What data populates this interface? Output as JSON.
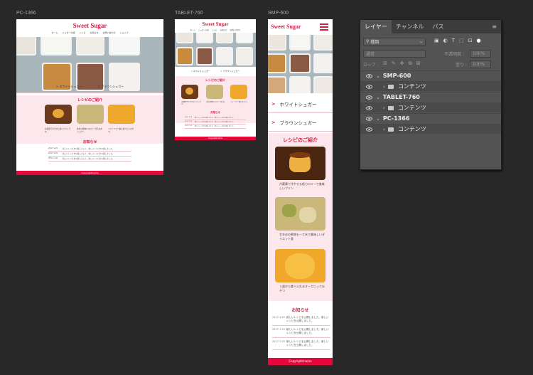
{
  "artboards": {
    "pc": {
      "label": "PC-1366",
      "logo": "Sweet Sugar",
      "nav": [
        "ホーム",
        "シュガーの話",
        "レシピ",
        "お知らせ",
        "お問い合わせ",
        "ショップ"
      ],
      "links": [
        "ホワイトシュガー",
        "ブラウンシュガー"
      ],
      "recipe_title": "レシピのご紹介",
      "recipes": [
        "冷蔵庫で冷やすと甘いプリンです。",
        "甘めの煮物にカロリー控えめのシュガー。",
        "フルーツと一緒に食べたいおやつ。"
      ],
      "news_title": "お知らせ",
      "news": [
        {
          "date": "2017.1.20",
          "text": "新しいレシピを公開しました。新しいレシピを公開しました。"
        },
        {
          "date": "2017.1.20",
          "text": "新しいレシピを公開しました。新しいレシピを公開しました。"
        },
        {
          "date": "2017.1.20",
          "text": "新しいレシピを公開しました。新しいレシピを公開しました。"
        }
      ],
      "footer": "Copyright/name"
    },
    "tablet": {
      "label": "TABLET-760",
      "logo": "Sweet Sugar",
      "nav": [
        "ホーム",
        "シュガーの話",
        "レシピ",
        "お知らせ",
        "お問い合わせ"
      ],
      "links": [
        "ホワイトシュガー",
        "ブラウンシュガー"
      ],
      "recipe_title": "レシピのご紹介",
      "recipes": [
        "冷蔵庫で冷やすと甘いプリンです。",
        "甘めの煮物にカロリー控えめ。",
        "フルーツと一緒に食べたい。"
      ],
      "news_title": "お知らせ",
      "news": [
        {
          "date": "2017.1.20",
          "text": "新しいレシピを公開しました。新しいレシピを公開しました。"
        },
        {
          "date": "2017.1.20",
          "text": "新しいレシピを公開しました。新しいレシピを公開しました。"
        },
        {
          "date": "2017.1.20",
          "text": "新しいレシピを公開しました。新しいレシピを公開しました。"
        }
      ],
      "footer": "Copyright/name"
    },
    "smp": {
      "label": "SMP-600",
      "logo": "Sweet Sugar",
      "links": [
        "ホワイトシュガー",
        "ブラウンシュガー"
      ],
      "recipe_title": "レシピのご紹介",
      "recipes": [
        "冷蔵庫で冷やせる低カロリーで美味しいプリン",
        "甘辛めの煮物も一工夫で美味しいダイエット食",
        "１歳から食べられるオーガニックおやつ"
      ],
      "news_title": "お知らせ",
      "news": [
        {
          "date": "2017.1.20",
          "text": "新しいレシピを公開しました。新しいレシピを公開しました。"
        },
        {
          "date": "2017.1.20",
          "text": "新しいレシピを公開しました。新しいレシピを公開しました。"
        },
        {
          "date": "2017.1.20",
          "text": "新しいレシピを公開しました。新しいレシピを公開しました。"
        }
      ],
      "footer": "Copyright/name"
    }
  },
  "layers_panel": {
    "tabs": [
      "レイヤー",
      "チャンネル",
      "パス"
    ],
    "filter_label": "種類",
    "blend_mode": "通常",
    "opacity_label": "不透明度 :",
    "opacity_value": "100%",
    "lock_label": "ロック :",
    "fill_label": "塗り :",
    "fill_value": "100%",
    "layers": [
      {
        "name": "SMP-600",
        "type": "artboard"
      },
      {
        "name": "コンテンツ",
        "type": "group"
      },
      {
        "name": "TABLET-760",
        "type": "artboard"
      },
      {
        "name": "コンテンツ",
        "type": "group"
      },
      {
        "name": "PC-1366",
        "type": "artboard"
      },
      {
        "name": "コンテンツ",
        "type": "group"
      }
    ]
  },
  "colors": {
    "accent": "#d81d46",
    "footer": "#e8073b",
    "recipe_bg": "#fce8ec",
    "canvas": "#282828",
    "panel": "#535353"
  }
}
